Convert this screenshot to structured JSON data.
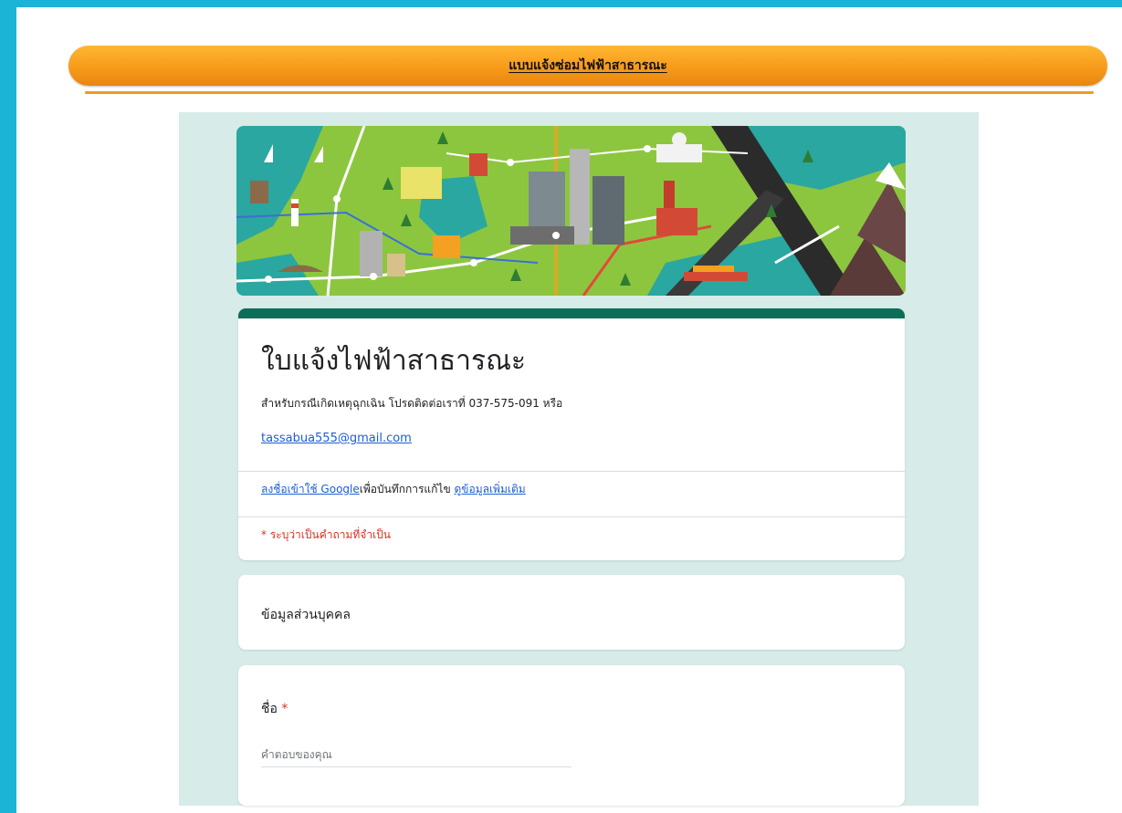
{
  "header": {
    "title": "แบบแจ้งซ่อมไฟฟ้าสาธารณะ"
  },
  "form": {
    "title": "ใบแจ้งไฟฟ้าสาธารณะ",
    "description": "สำหรับกรณีเกิดเหตุฉุกเฉิน โปรดติดต่อเราที่ 037-575-091 หรือ",
    "email": "tassabua555@gmail.com",
    "signin_link": "ลงชื่อเข้าใช้ Google",
    "signin_text": "เพื่อบันทึกการแก้ไข",
    "learn_more": "ดูข้อมูลเพิ่มเติม",
    "required_note": "* ระบุว่าเป็นคำถามที่จำเป็น"
  },
  "section": {
    "title": "ข้อมูลส่วนบุคคล"
  },
  "question": {
    "label": "ชื่อ",
    "required_mark": "*",
    "placeholder": "คำตอบของคุณ"
  },
  "colors": {
    "outer_background": "#1bb3d6",
    "title_pill": "#f79a1a",
    "form_background": "#d7ebe8",
    "form_accent": "#0b6e58",
    "link": "#1a5ed6",
    "required": "#d93025"
  },
  "banner": {
    "theme": "city-map-illustration"
  }
}
